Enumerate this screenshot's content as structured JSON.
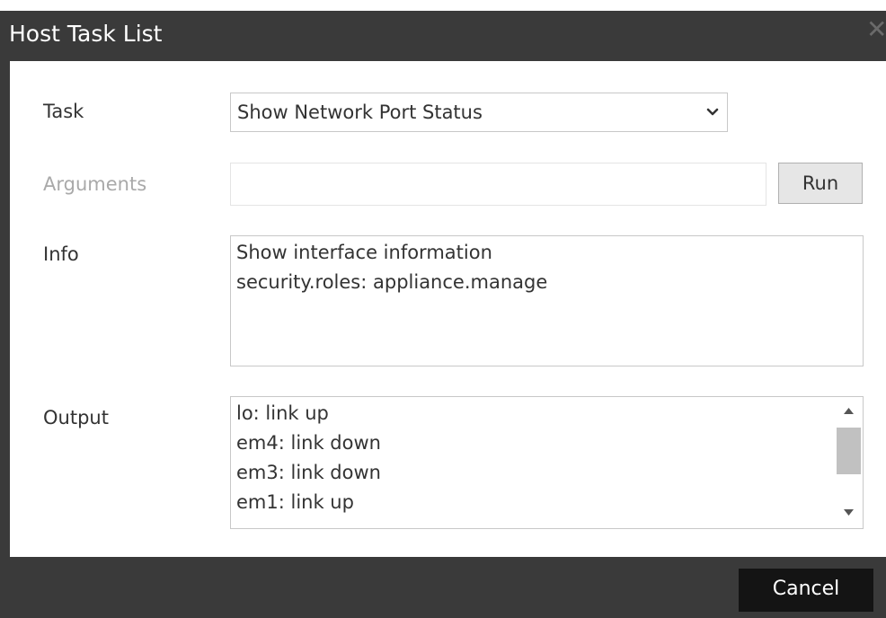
{
  "dialog": {
    "title": "Host Task List",
    "close_icon": "close-icon"
  },
  "form": {
    "task_label": "Task",
    "task_value": "Show Network Port Status",
    "arguments_label": "Arguments",
    "arguments_value": "",
    "arguments_placeholder": "",
    "run_label": "Run",
    "info_label": "Info",
    "info_lines": [
      "Show interface information",
      "security.roles: appliance.manage"
    ],
    "output_label": "Output",
    "output_lines": [
      "lo: link up",
      "em4: link down",
      "em3: link down",
      "em1: link up"
    ]
  },
  "footer": {
    "cancel_label": "Cancel"
  },
  "colors": {
    "titlebar": "#3a3a3a",
    "cancel_button": "#141414",
    "disabled_text": "#a9a9a9"
  }
}
